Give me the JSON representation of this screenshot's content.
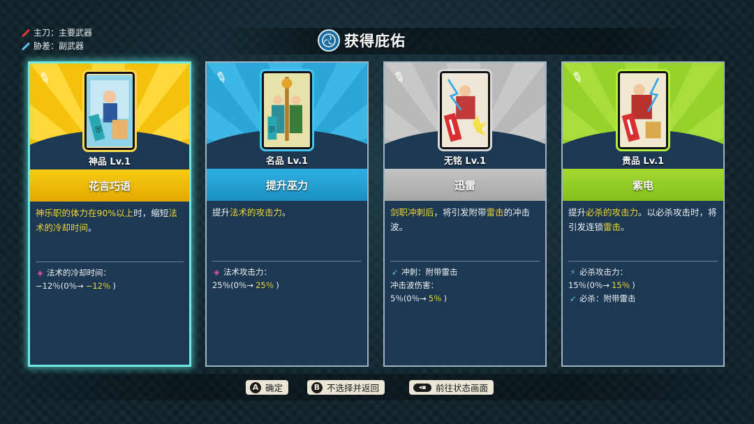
{
  "legend": {
    "main_label": "主刀：主要武器",
    "sub_label": "胁差：副武器"
  },
  "header": {
    "title": "获得庇佑",
    "emblem_icon": "mitsudomoe-icon"
  },
  "colors": {
    "gold": "#f4c20d",
    "blue": "#2aa6d8",
    "gray": "#b9b9b9",
    "green": "#97d12c",
    "highlight": "#f2d634",
    "selected_border": "#72e6e0"
  },
  "cards": [
    {
      "rank": "神品 Lv.1",
      "name": "花言巧语",
      "desc_parts": [
        {
          "t": "神乐职的体力在90%以上",
          "h": true
        },
        {
          "t": "时，缩短",
          "h": false
        },
        {
          "t": "法术的冷却时间",
          "h": true
        },
        {
          "t": "。",
          "h": false
        }
      ],
      "stats": [
        {
          "icon": "diamond-icon",
          "text": "法术的冷却时间：",
          "value": "",
          "h": false
        },
        {
          "icon": "",
          "text": "−12％(0％→",
          "value": "−12％",
          "tail": ")"
        }
      ]
    },
    {
      "rank": "名品 Lv.1",
      "name": "提升巫力",
      "desc_parts": [
        {
          "t": "提升",
          "h": false
        },
        {
          "t": "法术的攻击力",
          "h": true
        },
        {
          "t": "。",
          "h": false
        }
      ],
      "stats": [
        {
          "icon": "diamond-icon",
          "text": "法术攻击力：",
          "value": "",
          "h": false
        },
        {
          "icon": "",
          "text": "25％(0％→",
          "value": "25％",
          "tail": ")"
        }
      ]
    },
    {
      "rank": "无铭 Lv.1",
      "name": "迅雷",
      "desc_parts": [
        {
          "t": "剑职冲刺后",
          "h": true
        },
        {
          "t": "，将引发附带",
          "h": false
        },
        {
          "t": "雷击",
          "h": true
        },
        {
          "t": "的冲击波。",
          "h": false
        }
      ],
      "stats": [
        {
          "icon": "dash-icon",
          "text": "冲刺：附带雷击",
          "value": "",
          "h": false
        },
        {
          "icon": "",
          "text": "冲击波伤害：",
          "value": "",
          "tail": ""
        },
        {
          "icon": "",
          "text": "5％(0％→",
          "value": "5％",
          "tail": ")"
        }
      ]
    },
    {
      "rank": "贵品 Lv.1",
      "name": "紫电",
      "desc_parts": [
        {
          "t": "提升",
          "h": false
        },
        {
          "t": "必杀的攻击力",
          "h": true
        },
        {
          "t": "。以必杀攻击时，将引发连锁",
          "h": false
        },
        {
          "t": "雷击",
          "h": true
        },
        {
          "t": "。",
          "h": false
        }
      ],
      "stats": [
        {
          "icon": "lightning-icon",
          "text": "必杀攻击力：",
          "value": "",
          "h": false
        },
        {
          "icon": "",
          "text": "15％(0％→",
          "value": "15％",
          "tail": ")"
        },
        {
          "icon": "dash-icon",
          "text": "必杀：附带雷击",
          "value": "",
          "tail": ""
        }
      ]
    }
  ],
  "footer": {
    "confirm_glyph": "A",
    "confirm_label": "确定",
    "back_glyph": "B",
    "back_label": "不选择并返回",
    "status_glyph": "◂▪",
    "status_label": "前往状态画面"
  }
}
